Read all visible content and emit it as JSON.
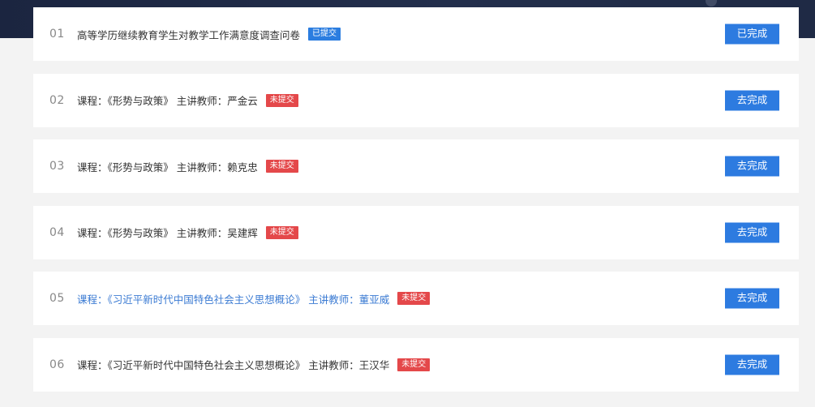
{
  "colors": {
    "banner": "#1f2a45",
    "page_bg": "#f3f3f3",
    "submitted_badge": "#2b7de0",
    "not_submitted_badge": "#e4484a",
    "action_button": "#2d7be0",
    "highlight_text": "#3b7bd3"
  },
  "surveys": [
    {
      "index": "01",
      "title": "高等学历继续教育学生对教学工作满意度调查问卷",
      "status": "已提交",
      "status_type": "submitted",
      "action": "已完成",
      "highlight": false
    },
    {
      "index": "02",
      "title": "课程：《形势与政策》 主讲教师：严金云",
      "status": "未提交",
      "status_type": "not_submitted",
      "action": "去完成",
      "highlight": false
    },
    {
      "index": "03",
      "title": "课程：《形势与政策》 主讲教师：赖克忠",
      "status": "未提交",
      "status_type": "not_submitted",
      "action": "去完成",
      "highlight": false
    },
    {
      "index": "04",
      "title": "课程：《形势与政策》 主讲教师：吴建辉",
      "status": "未提交",
      "status_type": "not_submitted",
      "action": "去完成",
      "highlight": false
    },
    {
      "index": "05",
      "title": "课程：《习近平新时代中国特色社会主义思想概论》 主讲教师：董亚威",
      "status": "未提交",
      "status_type": "not_submitted",
      "action": "去完成",
      "highlight": true
    },
    {
      "index": "06",
      "title": "课程：《习近平新时代中国特色社会主义思想概论》 主讲教师：王汉华",
      "status": "未提交",
      "status_type": "not_submitted",
      "action": "去完成",
      "highlight": false
    }
  ]
}
